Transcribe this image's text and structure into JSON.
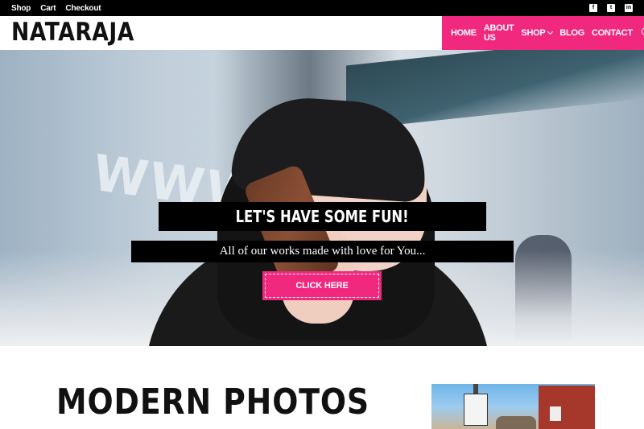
{
  "topbar": {
    "links": [
      "Shop",
      "Cart",
      "Checkout"
    ],
    "social_icons": [
      "facebook-icon",
      "twitter-icon",
      "linkedin-icon"
    ]
  },
  "header": {
    "logo": "NATARAJA",
    "nav": [
      {
        "label": "HOME"
      },
      {
        "label": "ABOUT US"
      },
      {
        "label": "SHOP",
        "has_dropdown": true
      },
      {
        "label": "BLOG"
      },
      {
        "label": "CONTACT"
      }
    ],
    "search_icon": "search-icon"
  },
  "hero": {
    "title": "LET'S HAVE SOME FUN!",
    "subtitle": "All of our works made with love for You...",
    "button_label": "CLICK HERE"
  },
  "section": {
    "title": "MODERN PHOTOS"
  },
  "colors": {
    "accent": "#f0287e",
    "topbar": "#000000",
    "text": "#111111"
  }
}
